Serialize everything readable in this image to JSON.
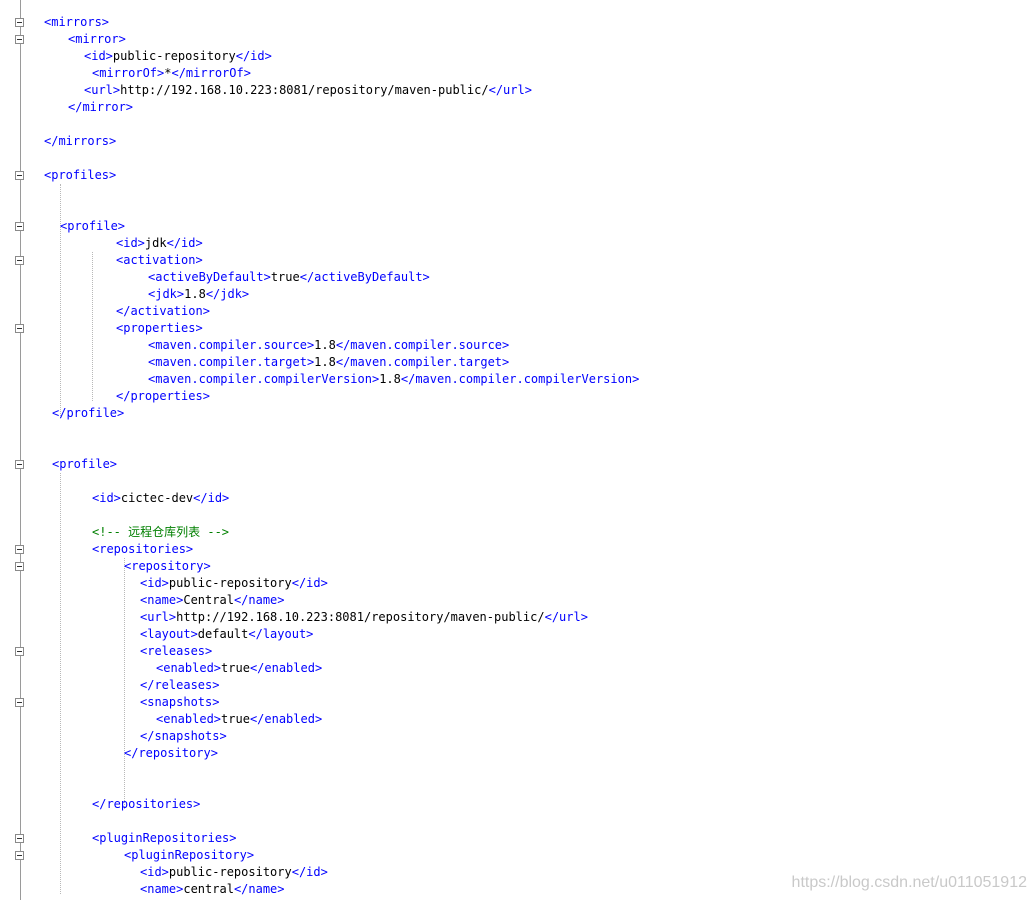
{
  "watermark": "https://blog.csdn.net/u011051912",
  "lines": [
    {
      "row": 1,
      "indent": 44,
      "segs": [
        {
          "t": "tag",
          "v": "<mirrors>"
        }
      ]
    },
    {
      "row": 2,
      "indent": 68,
      "segs": [
        {
          "t": "tag",
          "v": "<mirror>"
        }
      ]
    },
    {
      "row": 3,
      "indent": 84,
      "segs": [
        {
          "t": "tag",
          "v": "<id>"
        },
        {
          "t": "txt",
          "v": "public-repository"
        },
        {
          "t": "tag",
          "v": "</id>"
        }
      ]
    },
    {
      "row": 4,
      "indent": 92,
      "segs": [
        {
          "t": "tag",
          "v": "<mirrorOf>"
        },
        {
          "t": "txt",
          "v": "*"
        },
        {
          "t": "tag",
          "v": "</mirrorOf>"
        }
      ]
    },
    {
      "row": 5,
      "indent": 84,
      "segs": [
        {
          "t": "tag",
          "v": "<url>"
        },
        {
          "t": "txt",
          "v": "http://192.168.10.223:8081/repository/maven-public/"
        },
        {
          "t": "tag",
          "v": "</url>"
        }
      ]
    },
    {
      "row": 6,
      "indent": 68,
      "segs": [
        {
          "t": "tag",
          "v": "</mirror>"
        }
      ]
    },
    {
      "row": 8,
      "indent": 44,
      "segs": [
        {
          "t": "tag",
          "v": "</mirrors>"
        }
      ]
    },
    {
      "row": 10,
      "indent": 44,
      "segs": [
        {
          "t": "tag",
          "v": "<profiles>"
        }
      ]
    },
    {
      "row": 13,
      "indent": 60,
      "segs": [
        {
          "t": "tag",
          "v": "<profile>"
        }
      ]
    },
    {
      "row": 14,
      "indent": 116,
      "segs": [
        {
          "t": "tag",
          "v": "<id>"
        },
        {
          "t": "txt",
          "v": "jdk"
        },
        {
          "t": "tag",
          "v": "</id>"
        }
      ]
    },
    {
      "row": 15,
      "indent": 116,
      "segs": [
        {
          "t": "tag",
          "v": "<activation>"
        }
      ]
    },
    {
      "row": 16,
      "indent": 148,
      "segs": [
        {
          "t": "tag",
          "v": "<activeByDefault>"
        },
        {
          "t": "txt",
          "v": "true"
        },
        {
          "t": "tag",
          "v": "</activeByDefault>"
        }
      ]
    },
    {
      "row": 17,
      "indent": 148,
      "segs": [
        {
          "t": "tag",
          "v": "<jdk>"
        },
        {
          "t": "txt",
          "v": "1.8"
        },
        {
          "t": "tag",
          "v": "</jdk>"
        }
      ]
    },
    {
      "row": 18,
      "indent": 116,
      "segs": [
        {
          "t": "tag",
          "v": "</activation>"
        }
      ]
    },
    {
      "row": 19,
      "indent": 116,
      "segs": [
        {
          "t": "tag",
          "v": "<properties>"
        }
      ]
    },
    {
      "row": 20,
      "indent": 148,
      "segs": [
        {
          "t": "tag",
          "v": "<maven.compiler.source>"
        },
        {
          "t": "txt",
          "v": "1.8"
        },
        {
          "t": "tag",
          "v": "</maven.compiler.source>"
        }
      ]
    },
    {
      "row": 21,
      "indent": 148,
      "segs": [
        {
          "t": "tag",
          "v": "<maven.compiler.target>"
        },
        {
          "t": "txt",
          "v": "1.8"
        },
        {
          "t": "tag",
          "v": "</maven.compiler.target>"
        }
      ]
    },
    {
      "row": 22,
      "indent": 148,
      "segs": [
        {
          "t": "tag",
          "v": "<maven.compiler.compilerVersion>"
        },
        {
          "t": "txt",
          "v": "1.8"
        },
        {
          "t": "tag",
          "v": "</maven.compiler.compilerVersion>"
        }
      ]
    },
    {
      "row": 23,
      "indent": 116,
      "segs": [
        {
          "t": "tag",
          "v": "</properties>"
        }
      ]
    },
    {
      "row": 24,
      "indent": 52,
      "segs": [
        {
          "t": "tag",
          "v": "</profile>"
        }
      ]
    },
    {
      "row": 27,
      "indent": 52,
      "segs": [
        {
          "t": "tag",
          "v": "<profile>"
        }
      ]
    },
    {
      "row": 29,
      "indent": 92,
      "segs": [
        {
          "t": "tag",
          "v": "<id>"
        },
        {
          "t": "txt",
          "v": "cictec-dev"
        },
        {
          "t": "tag",
          "v": "</id>"
        }
      ]
    },
    {
      "row": 31,
      "indent": 92,
      "segs": [
        {
          "t": "cmt",
          "v": "<!-- 远程仓库列表 -->"
        }
      ]
    },
    {
      "row": 32,
      "indent": 92,
      "segs": [
        {
          "t": "tag",
          "v": "<repositories>"
        }
      ]
    },
    {
      "row": 33,
      "indent": 124,
      "segs": [
        {
          "t": "tag",
          "v": "<repository>"
        }
      ]
    },
    {
      "row": 34,
      "indent": 140,
      "segs": [
        {
          "t": "tag",
          "v": "<id>"
        },
        {
          "t": "txt",
          "v": "public-repository"
        },
        {
          "t": "tag",
          "v": "</id>"
        }
      ]
    },
    {
      "row": 35,
      "indent": 140,
      "segs": [
        {
          "t": "tag",
          "v": "<name>"
        },
        {
          "t": "txt",
          "v": "Central"
        },
        {
          "t": "tag",
          "v": "</name>"
        }
      ]
    },
    {
      "row": 36,
      "indent": 140,
      "segs": [
        {
          "t": "tag",
          "v": "<url>"
        },
        {
          "t": "txt",
          "v": "http://192.168.10.223:8081/repository/maven-public/"
        },
        {
          "t": "tag",
          "v": "</url>"
        }
      ]
    },
    {
      "row": 37,
      "indent": 140,
      "segs": [
        {
          "t": "tag",
          "v": "<layout>"
        },
        {
          "t": "txt",
          "v": "default"
        },
        {
          "t": "tag",
          "v": "</layout>"
        }
      ]
    },
    {
      "row": 38,
      "indent": 140,
      "segs": [
        {
          "t": "tag",
          "v": "<releases>"
        }
      ]
    },
    {
      "row": 39,
      "indent": 156,
      "segs": [
        {
          "t": "tag",
          "v": "<enabled>"
        },
        {
          "t": "txt",
          "v": "true"
        },
        {
          "t": "tag",
          "v": "</enabled>"
        }
      ]
    },
    {
      "row": 40,
      "indent": 140,
      "segs": [
        {
          "t": "tag",
          "v": "</releases>"
        }
      ]
    },
    {
      "row": 41,
      "indent": 140,
      "segs": [
        {
          "t": "tag",
          "v": "<snapshots>"
        }
      ]
    },
    {
      "row": 42,
      "indent": 156,
      "segs": [
        {
          "t": "tag",
          "v": "<enabled>"
        },
        {
          "t": "txt",
          "v": "true"
        },
        {
          "t": "tag",
          "v": "</enabled>"
        }
      ]
    },
    {
      "row": 43,
      "indent": 140,
      "segs": [
        {
          "t": "tag",
          "v": "</snapshots>"
        }
      ]
    },
    {
      "row": 44,
      "indent": 124,
      "segs": [
        {
          "t": "tag",
          "v": "</repository>"
        }
      ]
    },
    {
      "row": 47,
      "indent": 92,
      "segs": [
        {
          "t": "tag",
          "v": "</repositories>"
        }
      ]
    },
    {
      "row": 49,
      "indent": 92,
      "segs": [
        {
          "t": "tag",
          "v": "<pluginRepositories>"
        }
      ]
    },
    {
      "row": 50,
      "indent": 124,
      "segs": [
        {
          "t": "tag",
          "v": "<pluginRepository>"
        }
      ]
    },
    {
      "row": 51,
      "indent": 140,
      "segs": [
        {
          "t": "tag",
          "v": "<id>"
        },
        {
          "t": "txt",
          "v": "public-repository"
        },
        {
          "t": "tag",
          "v": "</id>"
        }
      ]
    },
    {
      "row": 52,
      "indent": 140,
      "segs": [
        {
          "t": "tag",
          "v": "<name>"
        },
        {
          "t": "txt",
          "v": "central"
        },
        {
          "t": "tag",
          "v": "</name>"
        }
      ]
    }
  ],
  "fold_rows": [
    1,
    2,
    10,
    13,
    15,
    19,
    27,
    32,
    33,
    38,
    41,
    49,
    50
  ]
}
